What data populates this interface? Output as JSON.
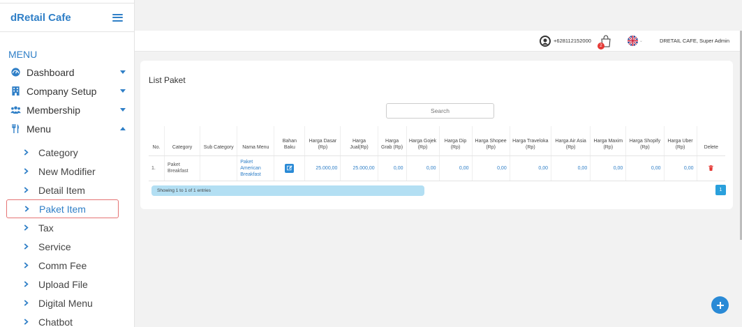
{
  "sidebar": {
    "brand": "dRetail Cafe",
    "menu_title": "MENU",
    "items": [
      {
        "label": "Dashboard",
        "icon": "dashboard-icon"
      },
      {
        "label": "Company Setup",
        "icon": "building-icon"
      },
      {
        "label": "Membership",
        "icon": "users-icon"
      },
      {
        "label": "Menu",
        "icon": "cutlery-icon"
      }
    ],
    "sub_items": [
      "Category",
      "New Modifier",
      "Detail Item",
      "Paket Item",
      "Tax",
      "Service",
      "Comm Fee",
      "Upload File",
      "Digital Menu",
      "Chatbot"
    ],
    "active_sub": "Paket Item"
  },
  "topbar": {
    "phone": "+628112152000",
    "cart_count": "2",
    "user": "DRETAIL CAFE, Super Admin"
  },
  "card": {
    "title": "List Paket",
    "search_placeholder": "Search",
    "columns": [
      "No.",
      "Category",
      "Sub Category",
      "Nama Menu",
      "Bahan Baku",
      "Harga Dasar (Rp)",
      "Harga Jual(Rp)",
      "Harga Grab (Rp)",
      "Harga Gojek (Rp)",
      "Harga Dip (Rp)",
      "Harga Shopee (Rp)",
      "Harga Traveloka (Rp)",
      "Harga Air Asia (Rp)",
      "Harga Maxim (Rp)",
      "Harga Shopify (Rp)",
      "Harga Uber (Rp)",
      "Delete"
    ],
    "rows": [
      {
        "no": "1.",
        "category": "Paket Breakfast",
        "sub_category": "",
        "nama_menu": "Paket American Breakfast",
        "harga_dasar": "25.000,00",
        "harga_jual": "25.000,00",
        "grab": "0,00",
        "gojek": "0,00",
        "dip": "0,00",
        "shopee": "0,00",
        "traveloka": "0,00",
        "air_asia": "0,00",
        "maxim": "0,00",
        "shopify": "0,00",
        "uber": "0,00"
      }
    ],
    "info": "Showing 1 to 1 of 1 entries",
    "page": "1"
  },
  "colors": {
    "accent": "#2f7fc7",
    "danger": "#e53935",
    "info_bar": "#b3dff3"
  }
}
